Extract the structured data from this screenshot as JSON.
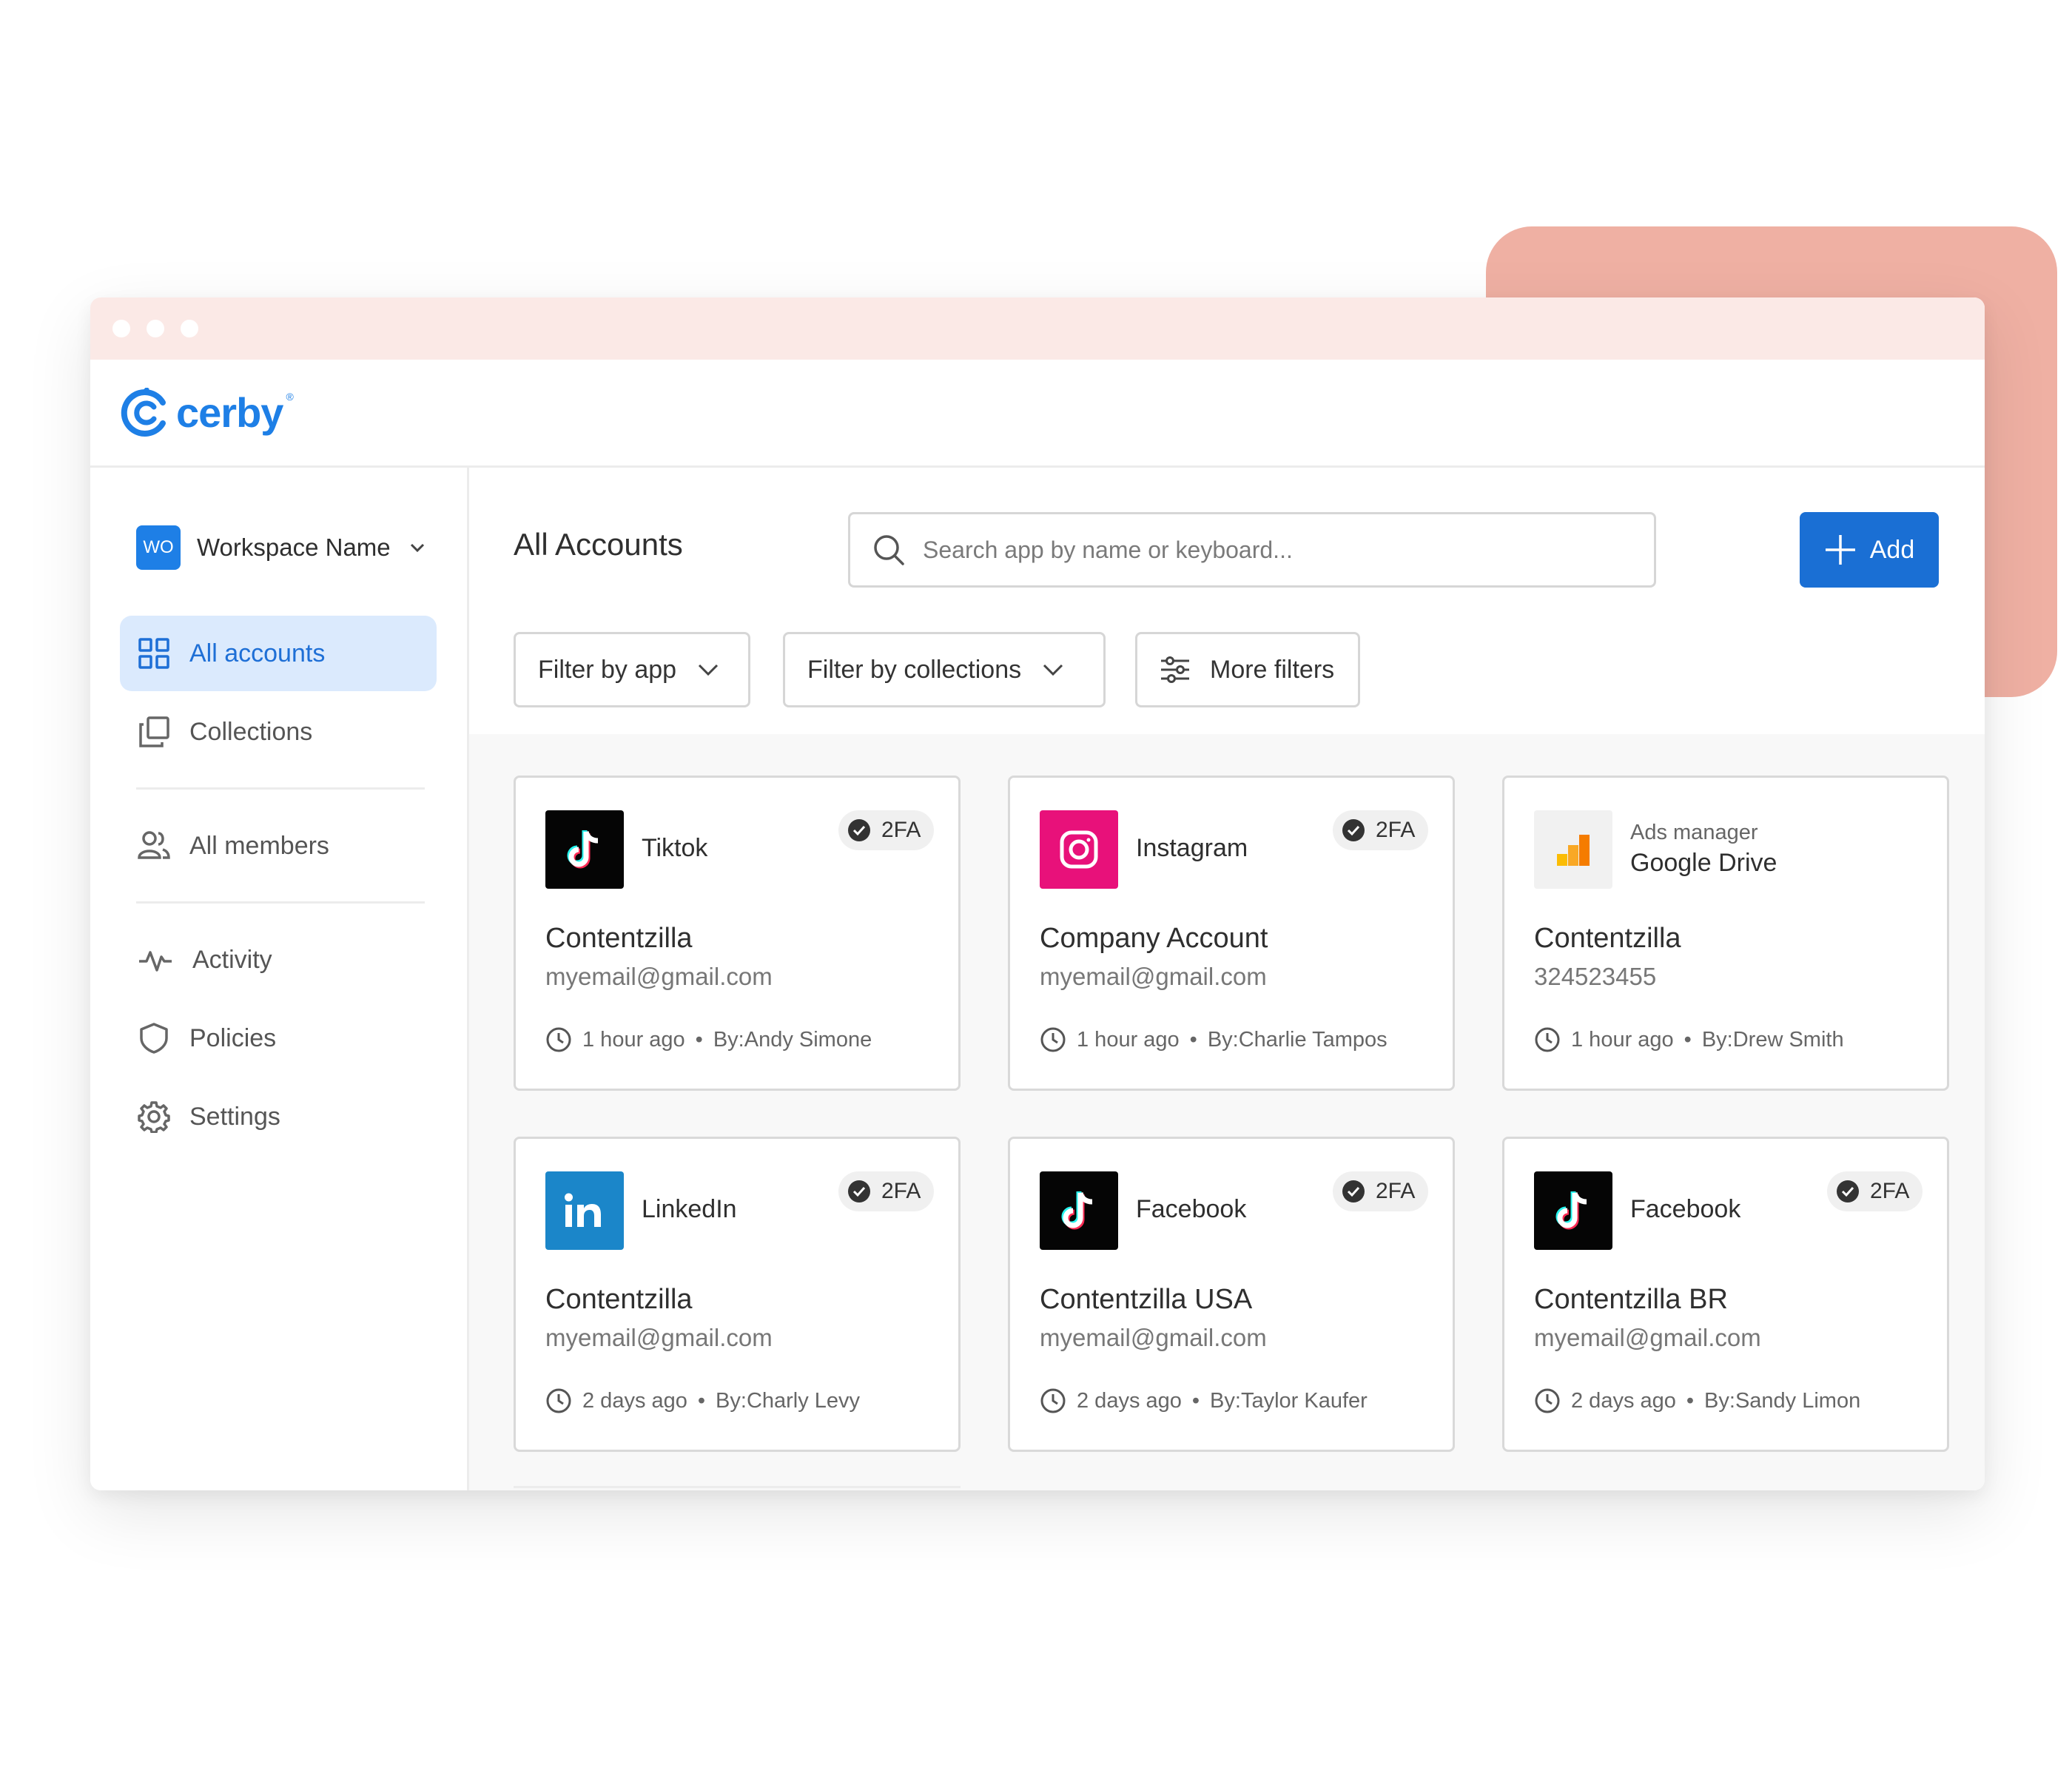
{
  "brand": {
    "name": "cerby",
    "trademark": "®",
    "color": "#1e7fe6"
  },
  "workspace": {
    "badge": "WO",
    "name": "Workspace Name"
  },
  "sidebar": {
    "items": [
      {
        "label": "All accounts",
        "icon": "grid-icon",
        "active": true
      },
      {
        "label": "Collections",
        "icon": "collections-icon"
      },
      {
        "label": "All members",
        "icon": "members-icon"
      },
      {
        "label": "Activity",
        "icon": "activity-icon"
      },
      {
        "label": "Policies",
        "icon": "shield-icon"
      },
      {
        "label": "Settings",
        "icon": "gear-icon"
      }
    ]
  },
  "main": {
    "title": "All Accounts",
    "search": {
      "placeholder": "Search app by name or keyboard..."
    },
    "add_label": "Add",
    "filters": {
      "app": "Filter by app",
      "collections": "Filter by collections",
      "more": "More filters"
    }
  },
  "cards": [
    {
      "app": "Tiktok",
      "icon": "tiktok-icon",
      "badge": "2FA",
      "account": "Contentzilla",
      "detail": "myemail@gmail.com",
      "time": "1 hour ago",
      "by": "By:Andy Simone"
    },
    {
      "app": "Instagram",
      "icon": "instagram-icon",
      "badge": "2FA",
      "account": "Company Account",
      "detail": "myemail@gmail.com",
      "time": "1 hour ago",
      "by": "By:Charlie Tampos"
    },
    {
      "app_sub": "Ads manager",
      "app": "Google Drive",
      "icon": "google-ads-icon",
      "account": "Contentzilla",
      "detail": "324523455",
      "time": "1 hour ago",
      "by": "By:Drew Smith"
    },
    {
      "app": "LinkedIn",
      "icon": "linkedin-icon",
      "badge": "2FA",
      "account": "Contentzilla",
      "detail": "myemail@gmail.com",
      "time": "2 days ago",
      "by": "By:Charly Levy"
    },
    {
      "app": "Facebook",
      "icon": "tiktok-icon",
      "badge": "2FA",
      "account": "Contentzilla USA",
      "detail": "myemail@gmail.com",
      "time": "2 days ago",
      "by": "By:Taylor Kaufer"
    },
    {
      "app": "Facebook",
      "icon": "tiktok-icon",
      "badge": "2FA",
      "account": "Contentzilla BR",
      "detail": "myemail@gmail.com",
      "time": "2 days ago",
      "by": "By:Sandy Limon"
    }
  ],
  "separator": "•",
  "colors": {
    "accent": "#1a6fd4",
    "active_nav_bg": "#dbeafd",
    "titlebar": "#fbe9e6",
    "deco": "#efb0a3",
    "instagram": "#e8117a",
    "linkedin": "#1b86c9"
  }
}
